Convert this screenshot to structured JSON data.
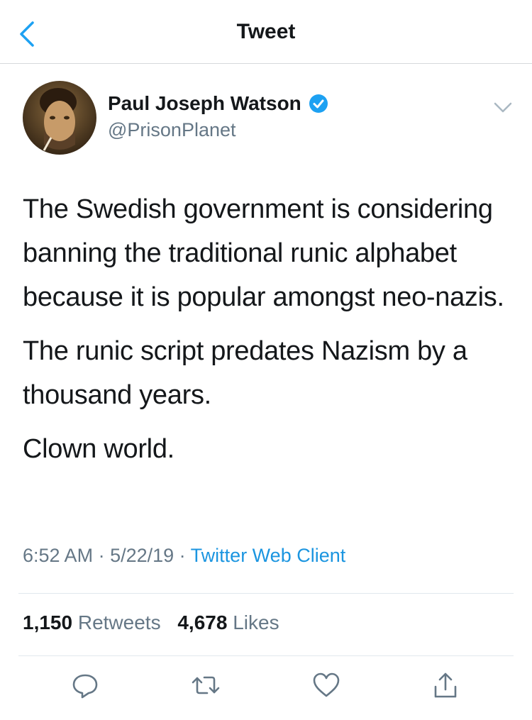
{
  "nav": {
    "title": "Tweet",
    "back_icon": "chevron-left-icon"
  },
  "author": {
    "name": "Paul Joseph Watson",
    "handle": "@PrisonPlanet",
    "verified": true
  },
  "tweet": {
    "paragraphs": [
      "The Swedish government is considering banning the traditional runic alphabet because it is popular amongst neo-nazis.",
      "The runic script predates Nazism by a thousand years.",
      "Clown world."
    ],
    "time": "6:52 AM",
    "date": "5/22/19",
    "separator": " · ",
    "source": "Twitter Web Client"
  },
  "stats": {
    "retweets_count": "1,150",
    "retweets_label": "Retweets",
    "likes_count": "4,678",
    "likes_label": "Likes"
  },
  "actions": [
    "reply-icon",
    "retweet-icon",
    "like-icon",
    "share-icon"
  ],
  "colors": {
    "accent": "#1b95e0",
    "muted": "#657786",
    "text": "#14171a"
  }
}
